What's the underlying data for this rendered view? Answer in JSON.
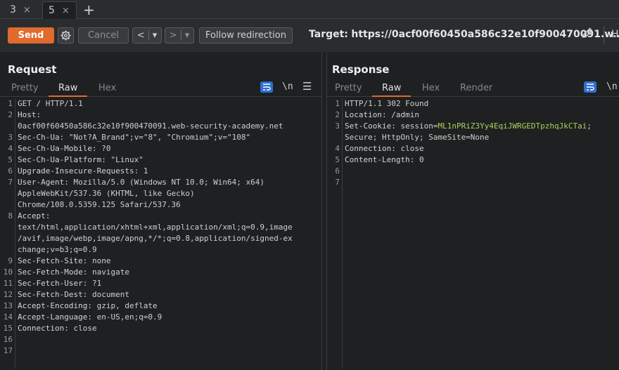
{
  "tabs": [
    {
      "label": "3",
      "close": "×"
    },
    {
      "label": "5",
      "close": "×"
    }
  ],
  "new_tab": "+",
  "toolbar": {
    "send_label": "Send",
    "cancel_label": "Cancel",
    "back_label": "<",
    "forward_label": ">",
    "dropdown_glyph": "▾",
    "follow_label": "Follow redirection",
    "target_label": "Target:",
    "target_url": "https://0acf00f60450a586c32e10f900470091.w...",
    "ht_label": "H"
  },
  "request": {
    "title": "Request",
    "tabs": [
      "Pretty",
      "Raw",
      "Hex"
    ],
    "active_tab": "Raw",
    "newline_toggle": "\\n",
    "lines": [
      {
        "n": "1",
        "key": "",
        "val": "GET / HTTP/1.1"
      },
      {
        "n": "2",
        "key": "Host",
        "val": ":"
      },
      {
        "n": "",
        "key": "",
        "val": "0acf00f60450a586c32e10f900470091.web-security-academy.net"
      },
      {
        "n": "3",
        "key": "Sec-Ch-Ua",
        "val": ": \"Not?A_Brand\";v=\"8\", \"Chromium\";v=\"108\""
      },
      {
        "n": "4",
        "key": "Sec-Ch-Ua-Mobile",
        "val": ": ?0"
      },
      {
        "n": "5",
        "key": "Sec-Ch-Ua-Platform",
        "val": ": \"Linux\""
      },
      {
        "n": "6",
        "key": "Upgrade-Insecure-Requests",
        "val": ": 1"
      },
      {
        "n": "7",
        "key": "User-Agent",
        "val": ": Mozilla/5.0 (Windows NT 10.0; Win64; x64)"
      },
      {
        "n": "",
        "key": "",
        "val": "AppleWebKit/537.36 (KHTML, like Gecko)"
      },
      {
        "n": "",
        "key": "",
        "val": "Chrome/108.0.5359.125 Safari/537.36"
      },
      {
        "n": "8",
        "key": "Accept",
        "val": ":"
      },
      {
        "n": "",
        "key": "",
        "val": "text/html,application/xhtml+xml,application/xml;q=0.9,image"
      },
      {
        "n": "",
        "key": "",
        "val": "/avif,image/webp,image/apng,*/*;q=0.8,application/signed-ex"
      },
      {
        "n": "",
        "key": "",
        "val": "change;v=b3;q=0.9"
      },
      {
        "n": "9",
        "key": "Sec-Fetch-Site",
        "val": ": none"
      },
      {
        "n": "10",
        "key": "Sec-Fetch-Mode",
        "val": ": navigate"
      },
      {
        "n": "11",
        "key": "Sec-Fetch-User",
        "val": ": ?1"
      },
      {
        "n": "12",
        "key": "Sec-Fetch-Dest",
        "val": ": document"
      },
      {
        "n": "13",
        "key": "Accept-Encoding",
        "val": ": gzip, deflate"
      },
      {
        "n": "14",
        "key": "Accept-Language",
        "val": ": en-US,en;q=0.9"
      },
      {
        "n": "15",
        "key": "Connection",
        "val": ": close"
      },
      {
        "n": "16",
        "key": "",
        "val": ""
      },
      {
        "n": "17",
        "key": "",
        "val": ""
      }
    ]
  },
  "response": {
    "title": "Response",
    "tabs": [
      "Pretty",
      "Raw",
      "Hex",
      "Render"
    ],
    "active_tab": "Raw",
    "newline_toggle": "\\n",
    "lines": [
      {
        "n": "1",
        "key": "",
        "val": "HTTP/1.1 302 Found"
      },
      {
        "n": "2",
        "key": "Location",
        "val": ": /admin"
      },
      {
        "n": "3",
        "key": "Set-Cookie",
        "val": ": session=",
        "cookie": "ML1nPRiZ3Yy4EqiJWRGEDTpzhqJkCTai",
        "rest": ";"
      },
      {
        "n": "",
        "key": "",
        "val": "Secure; HttpOnly; SameSite=None"
      },
      {
        "n": "4",
        "key": "Connection",
        "val": ": close"
      },
      {
        "n": "5",
        "key": "Content-Length",
        "val": ": 0"
      },
      {
        "n": "6",
        "key": "",
        "val": ""
      },
      {
        "n": "7",
        "key": "",
        "val": ""
      }
    ]
  },
  "colors": {
    "accent": "#e06b2c",
    "blue": "#2f6fd1",
    "cookie_green": "#a9d25b"
  }
}
